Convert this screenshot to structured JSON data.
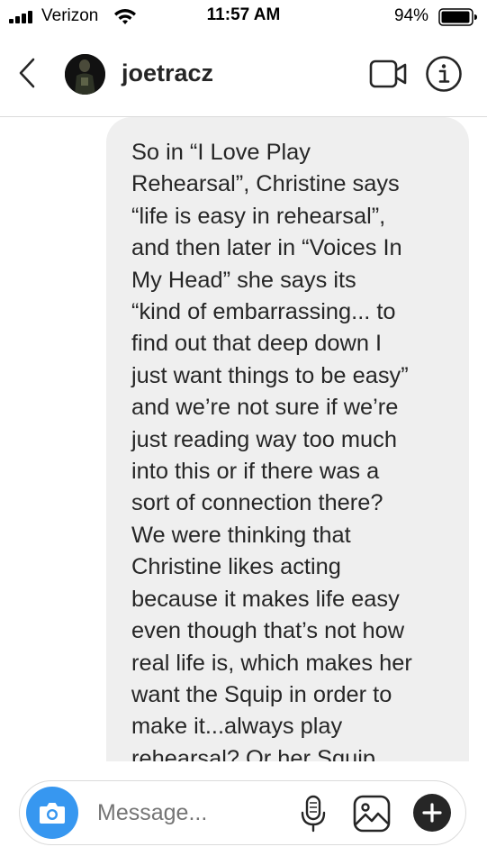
{
  "status_bar": {
    "carrier": "Verizon",
    "time": "11:57 AM",
    "battery": "94%"
  },
  "header": {
    "username": "joetracz",
    "icons": [
      "back-chevron-icon",
      "video-call-icon",
      "info-icon"
    ]
  },
  "messages": [
    {
      "sender": "me",
      "text": "So in “I Love Play\nRehearsal”, Christine says\n“life is easy in rehearsal”,\nand then later in “Voices In\nMy Head” she says its\n“kind of embarrassing... to\nfind out that deep down I\njust want things to be easy”\nand we’re not sure if we’re\njust reading way too much\ninto this or if there was a\nsort of connection there?\nWe were thinking that\nChristine likes acting\nbecause it makes life easy\neven though that’s not how\nreal life is, which makes her\nwant the Squip in order to\nmake it...always play\nrehearsal? Or her Squip"
    }
  ],
  "composer": {
    "placeholder": "Message...",
    "icons": [
      "camera-icon",
      "microphone-icon",
      "gallery-icon",
      "plus-icon"
    ]
  },
  "colors": {
    "accent": "#3797f0",
    "bubble": "#efefef",
    "text": "#262626",
    "placeholder": "#8e8e8e"
  }
}
